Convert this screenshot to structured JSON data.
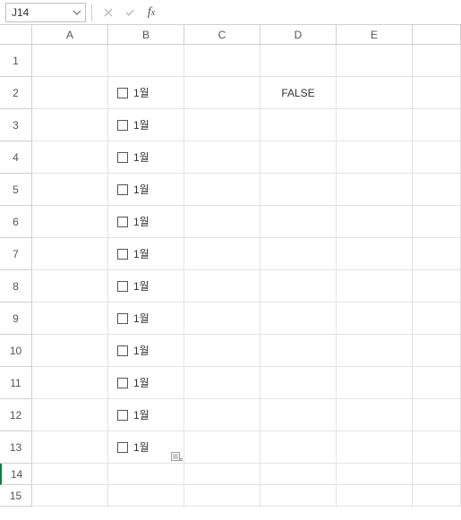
{
  "formula_bar": {
    "namebox_value": "J14",
    "formula_value": ""
  },
  "columns": [
    "A",
    "B",
    "C",
    "D",
    "E"
  ],
  "rows": [
    "1",
    "2",
    "3",
    "4",
    "5",
    "6",
    "7",
    "8",
    "9",
    "10",
    "11",
    "12",
    "13",
    "14",
    "15"
  ],
  "selected_row": "14",
  "checkbox_label": "1월",
  "cells": {
    "D2": "FALSE"
  },
  "checkbox_rows": [
    "2",
    "3",
    "4",
    "5",
    "6",
    "7",
    "8",
    "9",
    "10",
    "11",
    "12",
    "13"
  ],
  "chart_data": {
    "type": "table",
    "columns": [
      "A",
      "B",
      "C",
      "D",
      "E"
    ],
    "rows": [
      {
        "row": "1",
        "A": "",
        "B": "",
        "C": "",
        "D": "",
        "E": ""
      },
      {
        "row": "2",
        "A": "",
        "B": "[checkbox unchecked] 1월",
        "C": "",
        "D": "FALSE",
        "E": ""
      },
      {
        "row": "3",
        "A": "",
        "B": "[checkbox unchecked] 1월",
        "C": "",
        "D": "",
        "E": ""
      },
      {
        "row": "4",
        "A": "",
        "B": "[checkbox unchecked] 1월",
        "C": "",
        "D": "",
        "E": ""
      },
      {
        "row": "5",
        "A": "",
        "B": "[checkbox unchecked] 1월",
        "C": "",
        "D": "",
        "E": ""
      },
      {
        "row": "6",
        "A": "",
        "B": "[checkbox unchecked] 1월",
        "C": "",
        "D": "",
        "E": ""
      },
      {
        "row": "7",
        "A": "",
        "B": "[checkbox unchecked] 1월",
        "C": "",
        "D": "",
        "E": ""
      },
      {
        "row": "8",
        "A": "",
        "B": "[checkbox unchecked] 1월",
        "C": "",
        "D": "",
        "E": ""
      },
      {
        "row": "9",
        "A": "",
        "B": "[checkbox unchecked] 1월",
        "C": "",
        "D": "",
        "E": ""
      },
      {
        "row": "10",
        "A": "",
        "B": "[checkbox unchecked] 1월",
        "C": "",
        "D": "",
        "E": ""
      },
      {
        "row": "11",
        "A": "",
        "B": "[checkbox unchecked] 1월",
        "C": "",
        "D": "",
        "E": ""
      },
      {
        "row": "12",
        "A": "",
        "B": "[checkbox unchecked] 1월",
        "C": "",
        "D": "",
        "E": ""
      },
      {
        "row": "13",
        "A": "",
        "B": "[checkbox unchecked] 1월",
        "C": "",
        "D": "",
        "E": ""
      },
      {
        "row": "14",
        "A": "",
        "B": "",
        "C": "",
        "D": "",
        "E": ""
      },
      {
        "row": "15",
        "A": "",
        "B": "",
        "C": "",
        "D": "",
        "E": ""
      }
    ]
  }
}
